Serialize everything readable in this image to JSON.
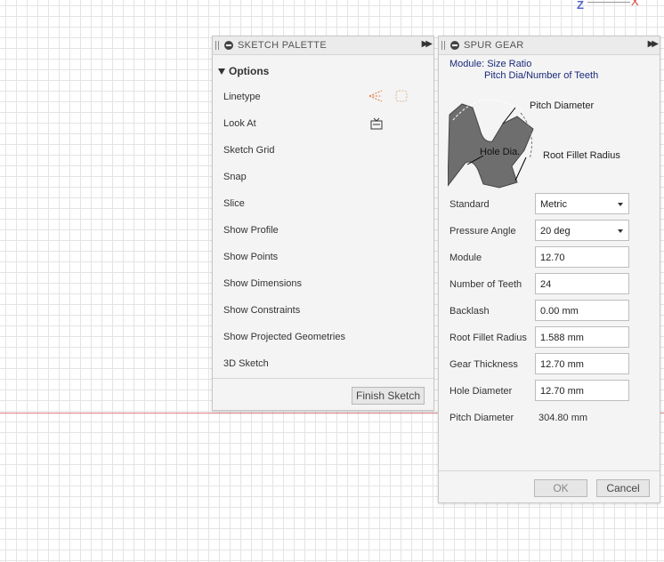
{
  "canvas": {
    "axis_z": "Z",
    "axis_x": "X"
  },
  "sketch_palette": {
    "title": "SKETCH PALETTE",
    "section": "Options",
    "rows": [
      {
        "label": "Linetype",
        "control": "linetype-icons"
      },
      {
        "label": "Look At",
        "control": "look-at-icon"
      },
      {
        "label": "Sketch Grid",
        "checked": true
      },
      {
        "label": "Snap",
        "checked": false
      },
      {
        "label": "Slice",
        "checked": false
      },
      {
        "label": "Show Profile",
        "checked": true
      },
      {
        "label": "Show Points",
        "checked": true
      },
      {
        "label": "Show Dimensions",
        "checked": true
      },
      {
        "label": "Show Constraints",
        "checked": true
      },
      {
        "label": "Show Projected Geometries",
        "checked": true
      },
      {
        "label": "3D Sketch",
        "checked": false
      }
    ],
    "finish_button": "Finish Sketch"
  },
  "spur_gear": {
    "title": "SPUR GEAR",
    "module_label": "Module:",
    "module_desc_1": "Size Ratio",
    "module_desc_2": "Pitch Dia/Number of Teeth",
    "figure": {
      "pitch_diameter": "Pitch Diameter",
      "hole_dia": "Hole Dia.",
      "root_fillet_radius": "Root Fillet Radius"
    },
    "standard": {
      "label": "Standard",
      "value": "Metric"
    },
    "pressure_angle": {
      "label": "Pressure Angle",
      "value": "20 deg"
    },
    "module": {
      "label": "Module",
      "value": "12.70"
    },
    "number_of_teeth": {
      "label": "Number of Teeth",
      "value": "24"
    },
    "backlash": {
      "label": "Backlash",
      "value": "0.00 mm"
    },
    "root_fillet": {
      "label": "Root Fillet Radius",
      "value": "1.588 mm"
    },
    "gear_thickness": {
      "label": "Gear Thickness",
      "value": "12.70 mm"
    },
    "hole_diameter": {
      "label": "Hole Diameter",
      "value": "12.70 mm"
    },
    "pitch_diameter": {
      "label": "Pitch Diameter",
      "value": "304.80 mm"
    },
    "ok_button": "OK",
    "cancel_button": "Cancel"
  },
  "colors": {
    "accent_text": "#1a2a7a",
    "gear_fill": "#6e6e6e",
    "canvas_axis_line": "#d98080"
  }
}
